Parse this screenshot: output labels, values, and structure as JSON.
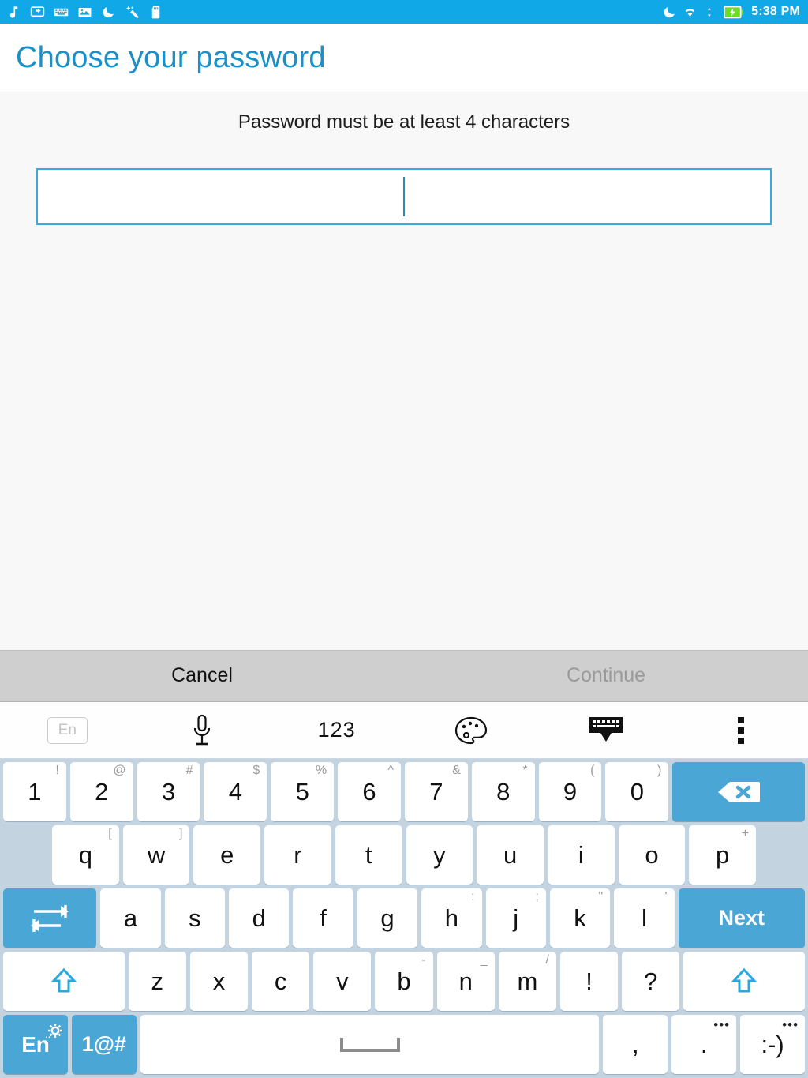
{
  "statusbar": {
    "icons": [
      "music-note-icon",
      "screencast-icon",
      "keyboard-icon",
      "photo-icon",
      "do-not-disturb-moon-icon",
      "magic-wand-icon",
      "sd-card-icon"
    ],
    "right_icons": [
      "moon-icon",
      "wifi-icon",
      "battery-charging-icon"
    ],
    "time": "5:38 PM"
  },
  "header": {
    "title": "Choose your password"
  },
  "main": {
    "hint": "Password must be at least 4 characters",
    "password_value": "",
    "password_placeholder": ""
  },
  "actions": {
    "cancel_label": "Cancel",
    "continue_label": "Continue"
  },
  "keyboard": {
    "toolbar": [
      {
        "name": "language-badge",
        "label": "En",
        "type": "badge"
      },
      {
        "name": "microphone-icon",
        "label": "",
        "type": "mic"
      },
      {
        "name": "numbers-toggle",
        "label": "123",
        "type": "text"
      },
      {
        "name": "theme-palette-icon",
        "label": "",
        "type": "palette"
      },
      {
        "name": "hide-keyboard-icon",
        "label": "",
        "type": "hide"
      },
      {
        "name": "overflow-menu-icon",
        "label": "",
        "type": "overflow"
      }
    ],
    "row_numbers": [
      {
        "main": "1",
        "sub": "!"
      },
      {
        "main": "2",
        "sub": "@"
      },
      {
        "main": "3",
        "sub": "#"
      },
      {
        "main": "4",
        "sub": "$"
      },
      {
        "main": "5",
        "sub": "%"
      },
      {
        "main": "6",
        "sub": "^"
      },
      {
        "main": "7",
        "sub": "&"
      },
      {
        "main": "8",
        "sub": "*"
      },
      {
        "main": "9",
        "sub": "("
      },
      {
        "main": "0",
        "sub": ")"
      }
    ],
    "backspace_label": "",
    "row_top": [
      {
        "main": "q",
        "sub": "["
      },
      {
        "main": "w",
        "sub": "]"
      },
      {
        "main": "e",
        "sub": ""
      },
      {
        "main": "r",
        "sub": ""
      },
      {
        "main": "t",
        "sub": ""
      },
      {
        "main": "y",
        "sub": ""
      },
      {
        "main": "u",
        "sub": ""
      },
      {
        "main": "i",
        "sub": ""
      },
      {
        "main": "o",
        "sub": ""
      },
      {
        "main": "p",
        "sub": "+"
      }
    ],
    "tab_label": "",
    "row_home": [
      {
        "main": "a",
        "sub": ""
      },
      {
        "main": "s",
        "sub": ""
      },
      {
        "main": "d",
        "sub": ""
      },
      {
        "main": "f",
        "sub": ""
      },
      {
        "main": "g",
        "sub": ""
      },
      {
        "main": "h",
        "sub": ":"
      },
      {
        "main": "j",
        "sub": ";"
      },
      {
        "main": "k",
        "sub": "\""
      },
      {
        "main": "l",
        "sub": "'"
      }
    ],
    "enter_label": "Next",
    "row_bottom": [
      {
        "main": "z",
        "sub": ""
      },
      {
        "main": "x",
        "sub": ""
      },
      {
        "main": "c",
        "sub": ""
      },
      {
        "main": "v",
        "sub": ""
      },
      {
        "main": "b",
        "sub": "-"
      },
      {
        "main": "n",
        "sub": "_"
      },
      {
        "main": "m",
        "sub": "/"
      },
      {
        "main": "!",
        "sub": ""
      },
      {
        "main": "?",
        "sub": ""
      }
    ],
    "shift_label": "",
    "row_space": {
      "lang_label": "En",
      "symbols_label": "1@#",
      "space_label": "",
      "comma_label": ",",
      "period_label": ".",
      "period_dots": "•••",
      "emoji_label": ":-)",
      "emoji_dots": "•••"
    }
  },
  "colors": {
    "accent": "#11a8e8",
    "title": "#1b8fc6",
    "key_blue": "#4aa6d4",
    "keyboard_bg": "#c3d3e0",
    "actionbar_bg": "#cfcfcf",
    "field_border": "#3aa9dd"
  }
}
